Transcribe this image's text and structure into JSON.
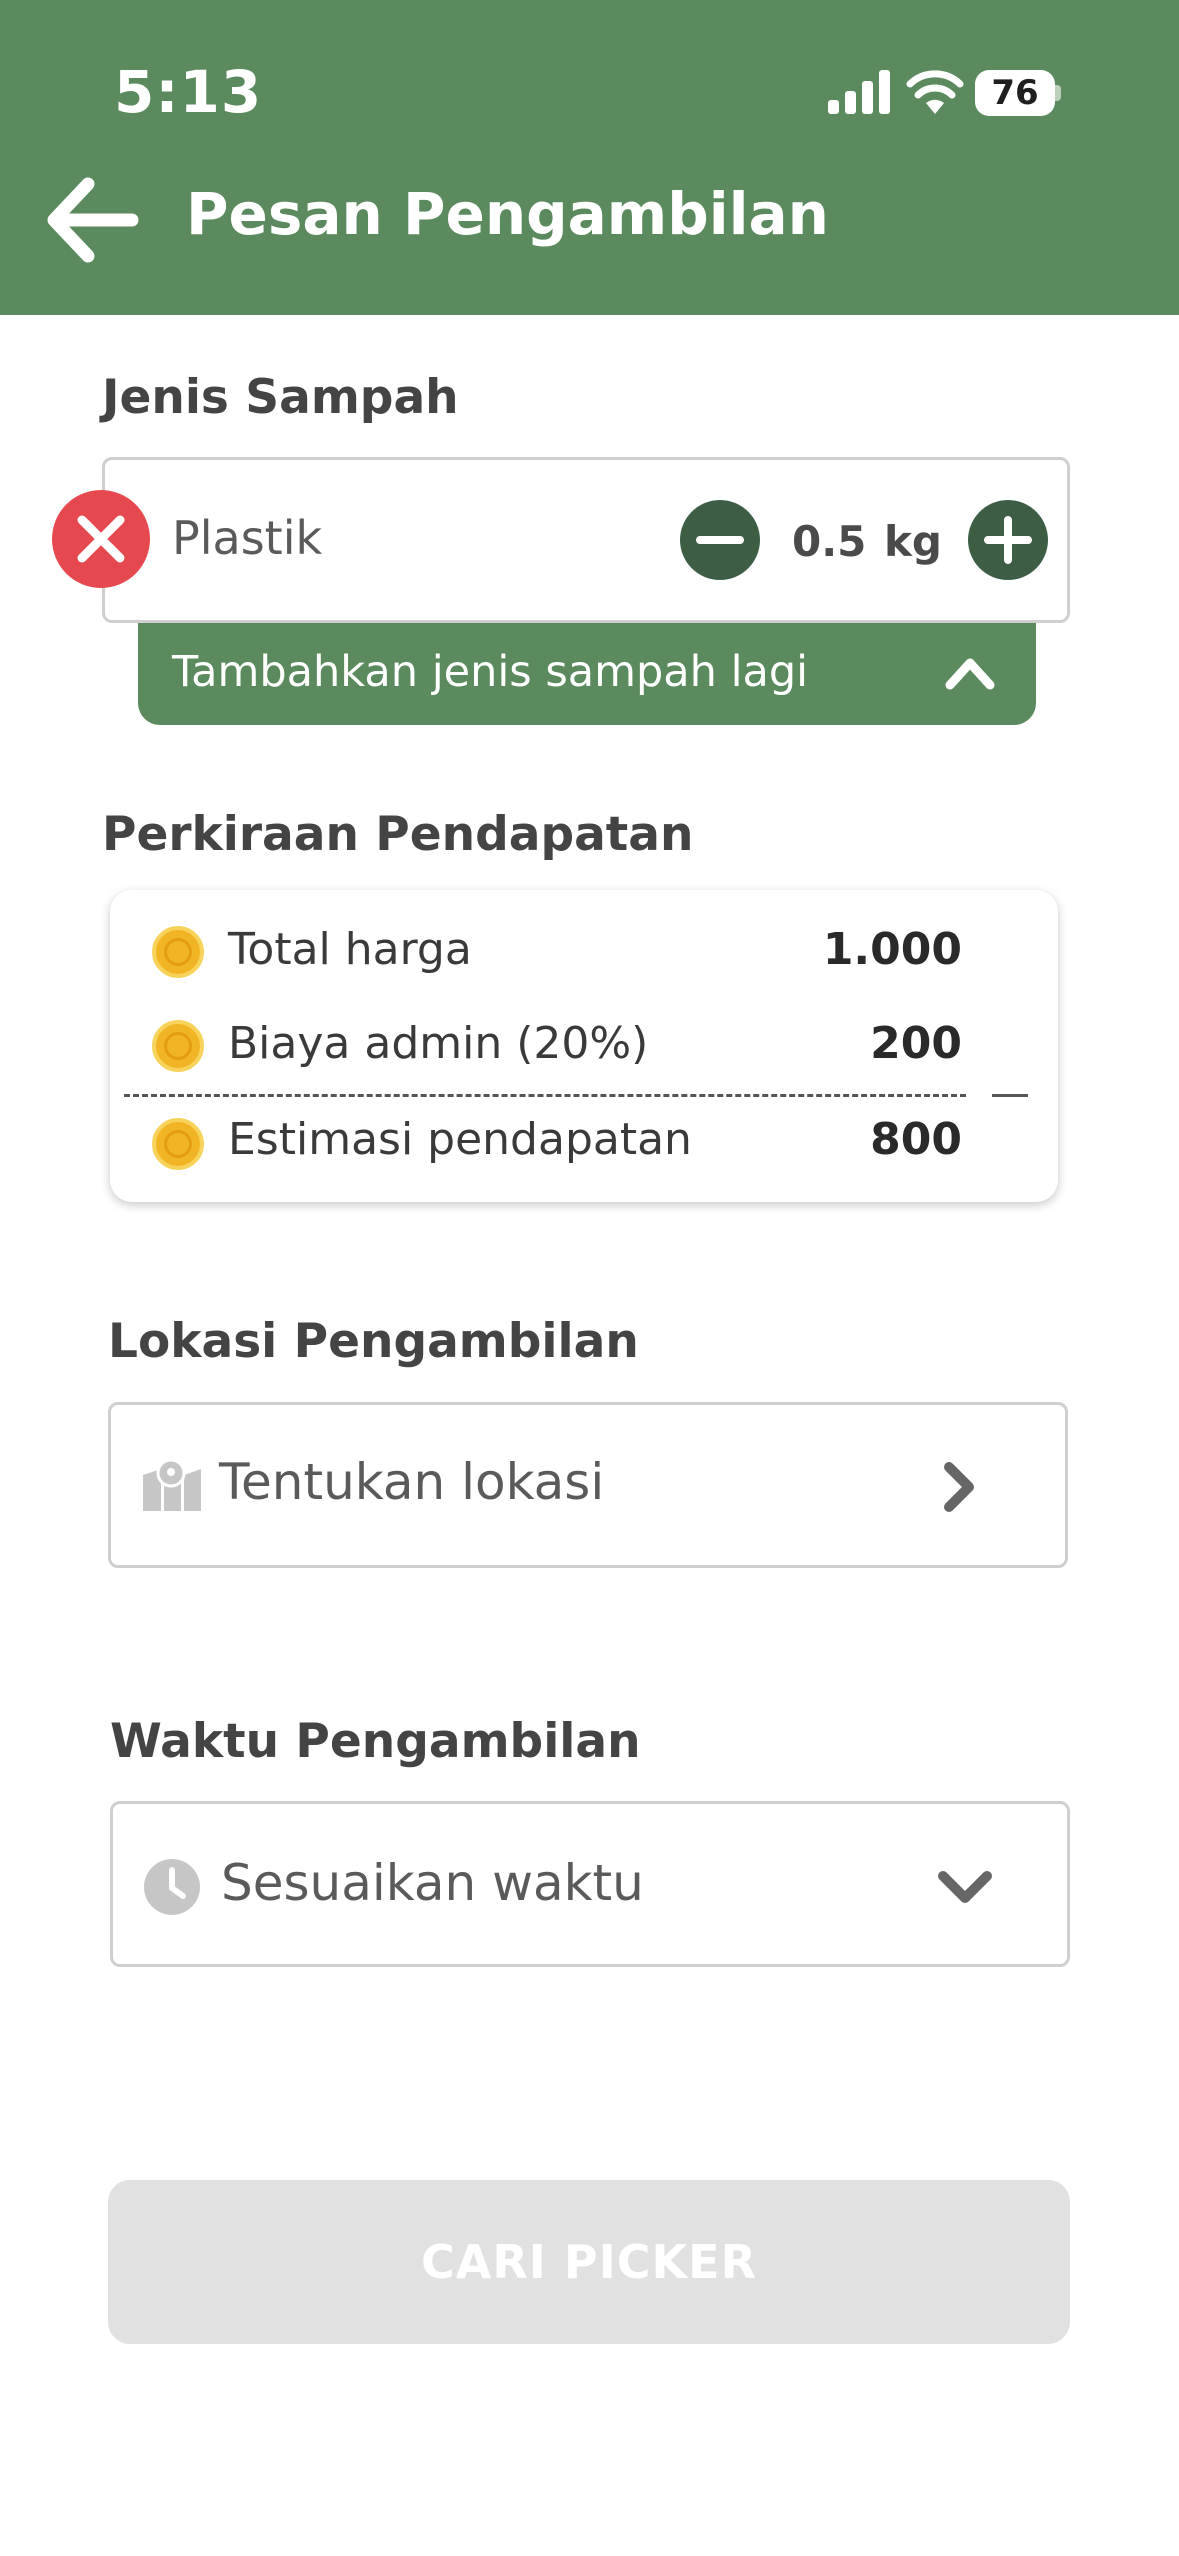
{
  "status_bar": {
    "time": "5:13",
    "battery": "76"
  },
  "header": {
    "title": "Pesan Pengambilan",
    "back_icon": "arrow-left-icon"
  },
  "waste": {
    "section_title": "Jenis Sampah",
    "item": {
      "name": "Plastik",
      "quantity": "0.5",
      "unit": "kg"
    },
    "add_more_label": "Tambahkan jenis sampah lagi"
  },
  "earnings": {
    "section_title": "Perkiraan Pendapatan",
    "rows": [
      {
        "label": "Total harga",
        "value": "1.000"
      },
      {
        "label": "Biaya admin (20%)",
        "value": "200"
      },
      {
        "label": "Estimasi pendapatan",
        "value": "800"
      }
    ]
  },
  "location": {
    "section_title": "Lokasi Pengambilan",
    "placeholder": "Tentukan lokasi"
  },
  "time": {
    "section_title": "Waktu Pengambilan",
    "placeholder": "Sesuaikan waktu"
  },
  "cta": {
    "label": "CARI PICKER"
  },
  "colors": {
    "primary": "#5a8a5d",
    "dark_green": "#3d5e45",
    "danger": "#e5484e",
    "coin": "#f1b425",
    "disabled": "#e1e1e1"
  }
}
